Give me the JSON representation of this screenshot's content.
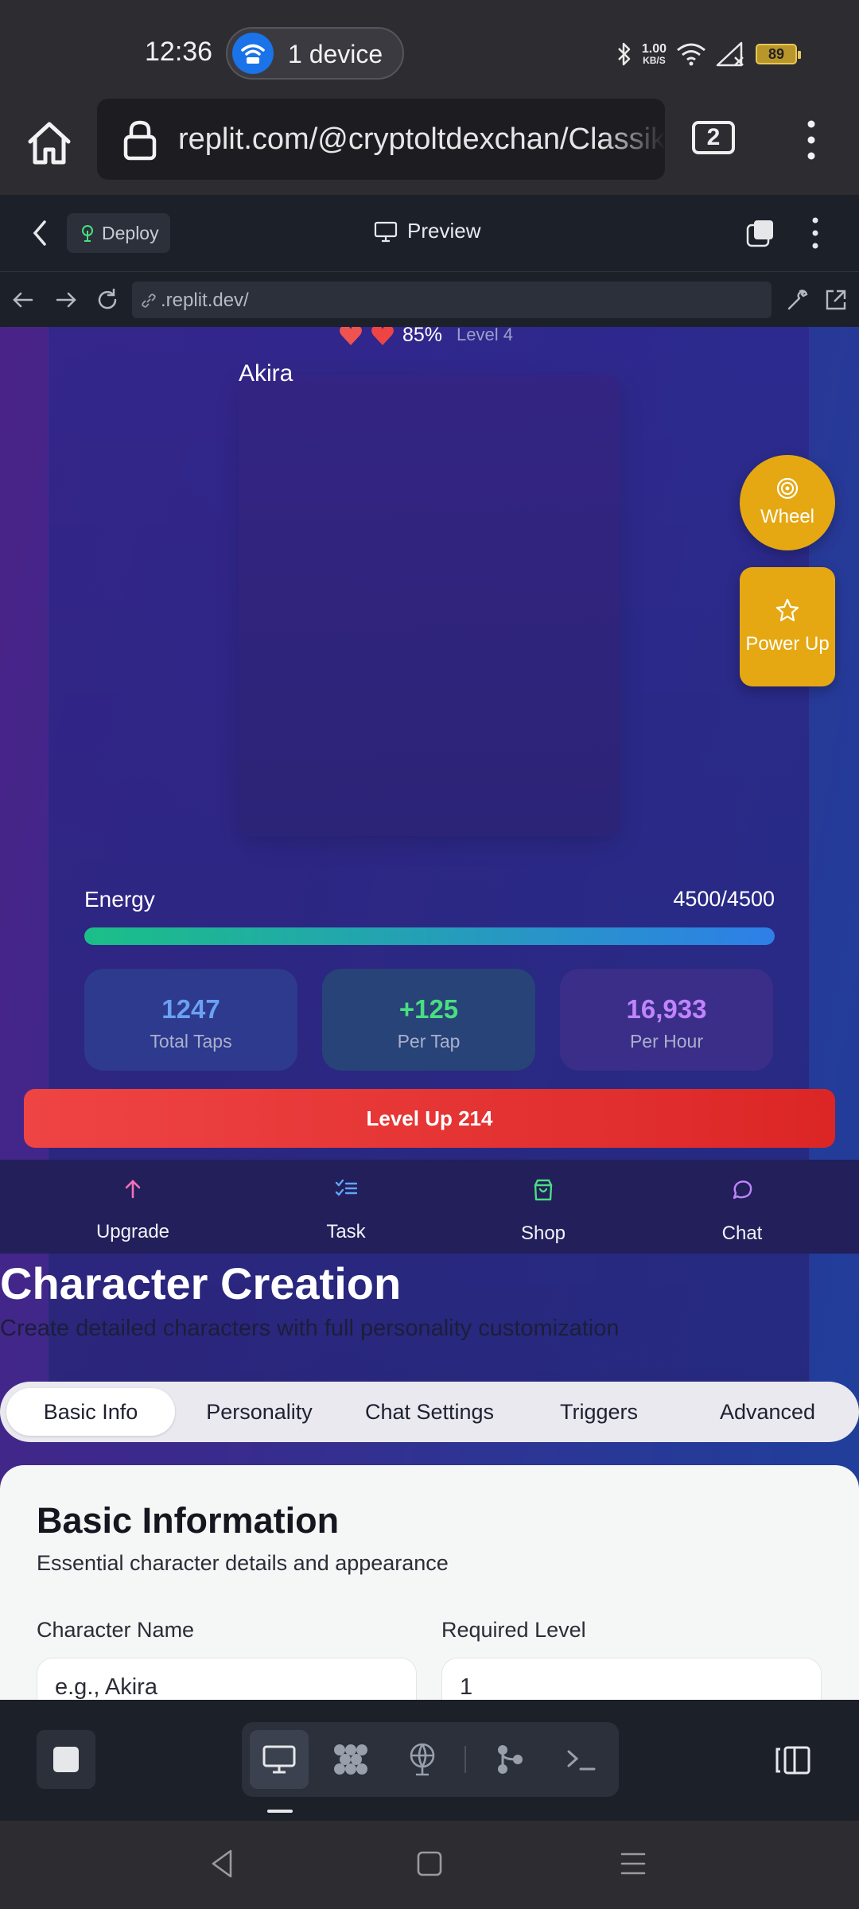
{
  "status_bar": {
    "time": "12:36",
    "hotspot": "1 device",
    "net_speed_value": "1.00",
    "net_speed_unit": "KB/S",
    "battery": "89"
  },
  "browser": {
    "url": "replit.com/@cryptoltdexchan/ClassikLust",
    "tab_count": "2"
  },
  "replit": {
    "deploy_label": "Deploy",
    "preview_label": "Preview",
    "webview_url": ".replit.dev/"
  },
  "game": {
    "affection": "85%",
    "level": "Level 4",
    "character_name": "Akira",
    "fab_wheel": "Wheel",
    "fab_power_up": "Power Up",
    "energy_label": "Energy",
    "energy_value": "4500/4500",
    "energy_fraction": 1.0,
    "stats": [
      {
        "value": "1247",
        "label": "Total Taps"
      },
      {
        "value": "+125",
        "label": "Per Tap"
      },
      {
        "value": "16,933",
        "label": "Per Hour"
      }
    ],
    "level_up_label": "Level Up  214"
  },
  "bottom_nav": [
    {
      "label": "Upgrade",
      "icon": "arrow-up-icon",
      "color": "#f472b6"
    },
    {
      "label": "Task",
      "icon": "list-check-icon",
      "color": "#60a5fa"
    },
    {
      "label": "Shop",
      "icon": "shopping-bag-icon",
      "color": "#4ade80"
    },
    {
      "label": "Chat",
      "icon": "message-circle-icon",
      "color": "#c084fc"
    }
  ],
  "creation": {
    "title": "Character Creation",
    "subtitle": "Create detailed characters with full personality customization",
    "tabs": [
      "Basic Info",
      "Personality",
      "Chat Settings",
      "Triggers",
      "Advanced"
    ],
    "active_tab": "Basic Info",
    "section_title": "Basic Information",
    "section_subtitle": "Essential character details and appearance",
    "name_label": "Character Name",
    "name_placeholder": "e.g., Akira",
    "level_label": "Required Level",
    "level_value": "1"
  },
  "colors": {
    "accent_gold": "#e5a812",
    "level_up_red": "#ef4444",
    "energy_start": "#1bbf87",
    "energy_end": "#2e7fe8"
  }
}
